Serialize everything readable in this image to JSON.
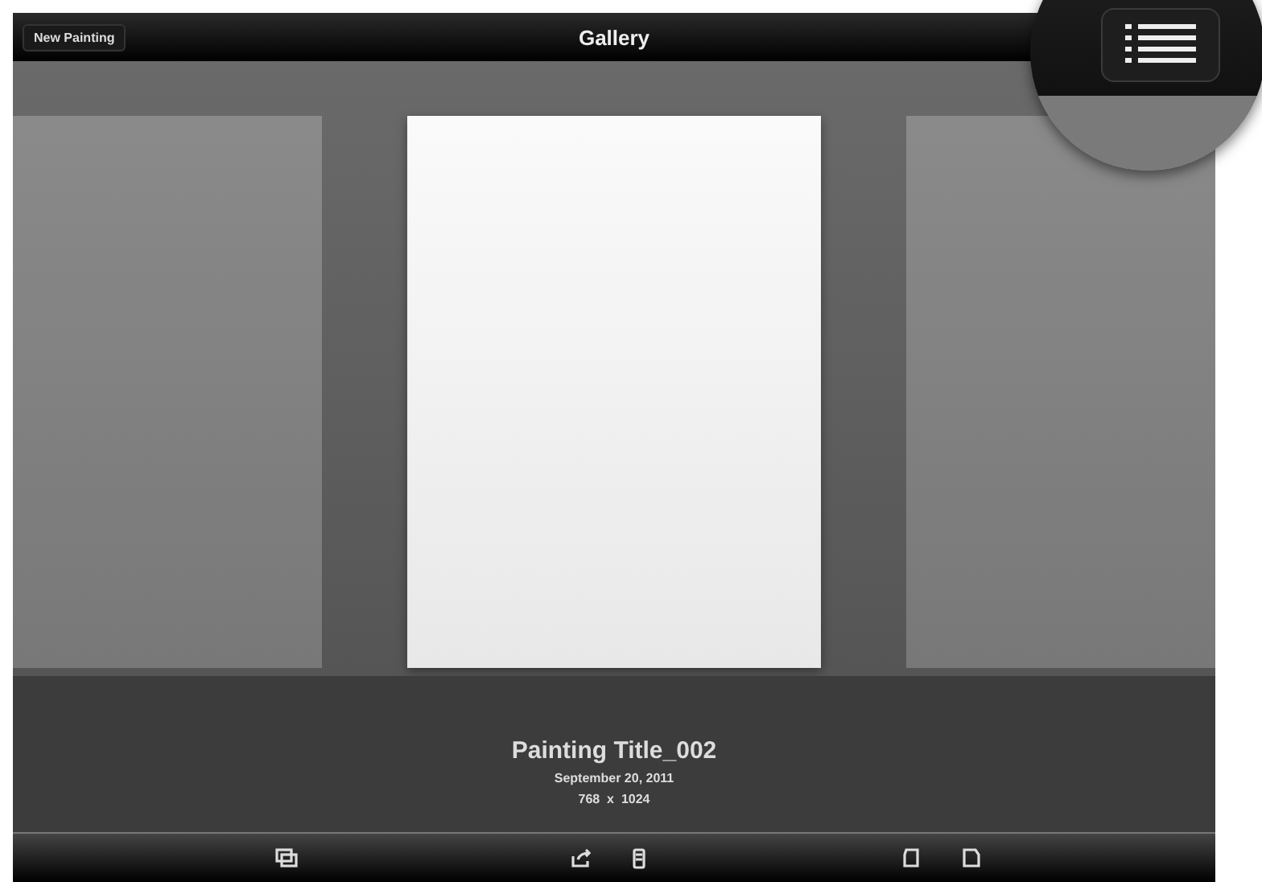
{
  "nav_bar": {
    "title": "Gallery",
    "new_button": "New Painting"
  },
  "painting": {
    "title": "Painting Title_002",
    "date": "September 20, 2011",
    "size": "768  x  1024"
  }
}
